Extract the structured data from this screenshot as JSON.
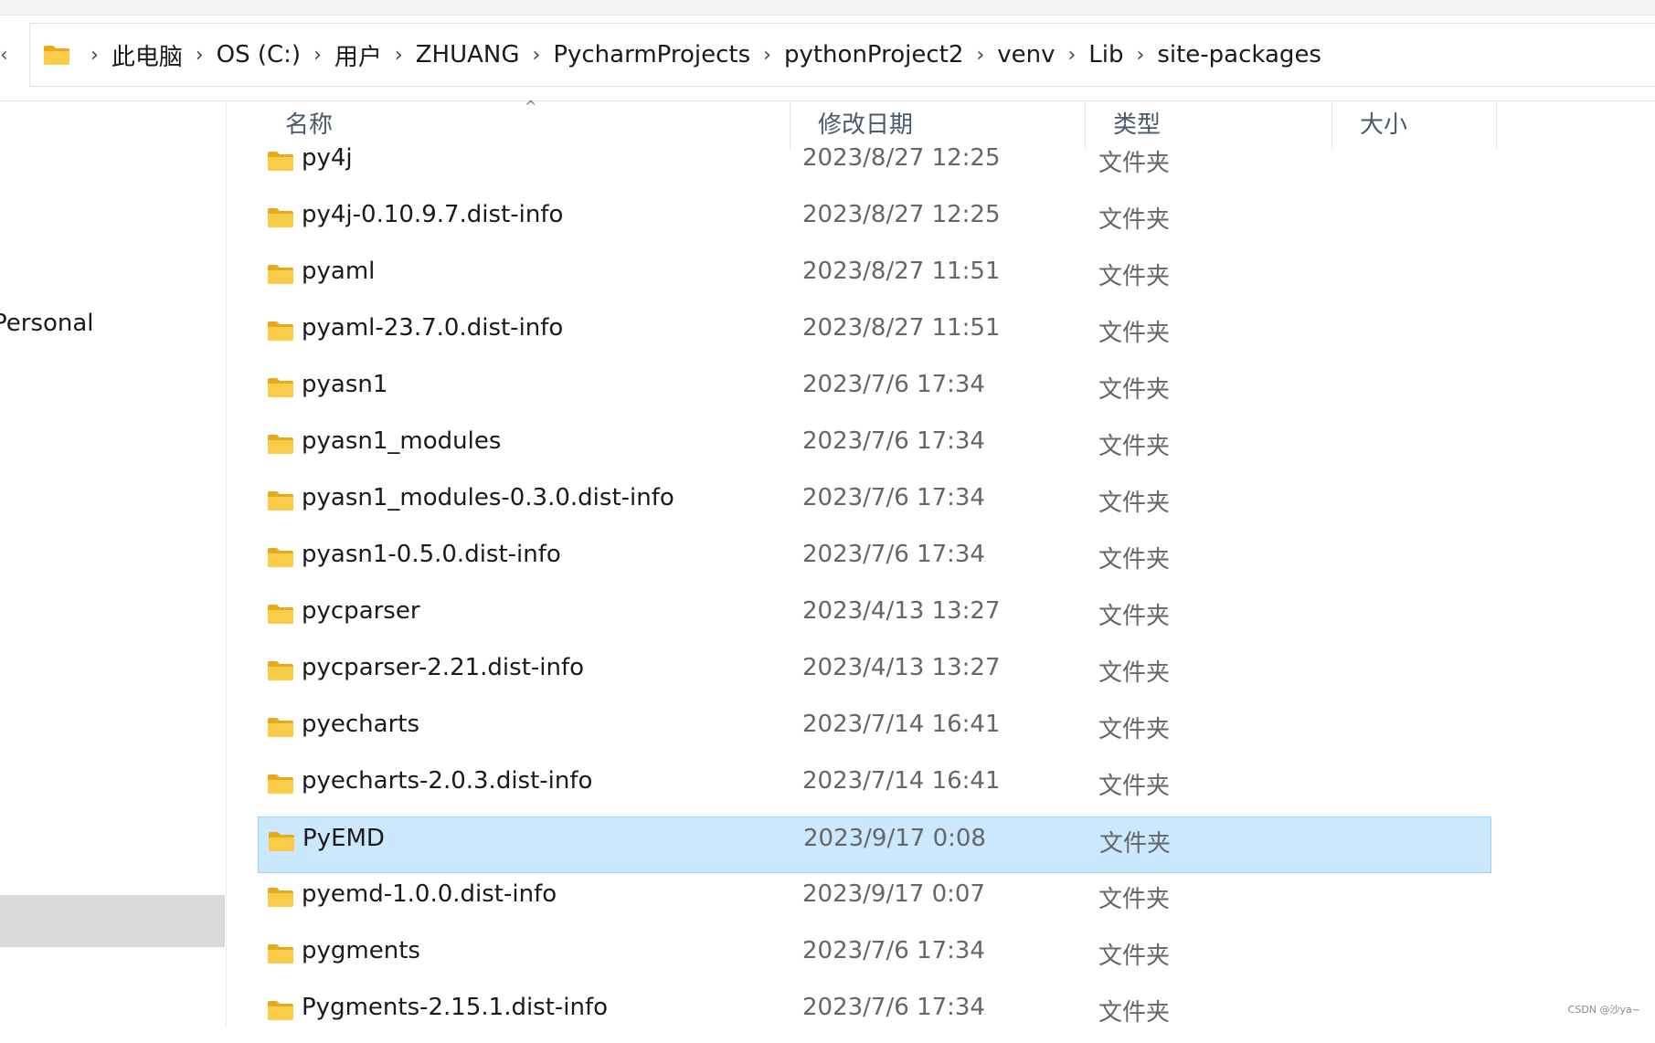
{
  "breadcrumb": {
    "items": [
      "此电脑",
      "OS (C:)",
      "用户",
      "ZHUANG",
      "PycharmProjects",
      "pythonProject2",
      "venv",
      "Lib",
      "site-packages"
    ],
    "separator": "›"
  },
  "nav_pane": {
    "visible_item": "Personal"
  },
  "columns": {
    "name": "名称",
    "date": "修改日期",
    "type": "类型",
    "size": "大小"
  },
  "files": [
    {
      "name": "py4j",
      "date": "2023/8/27 12:25",
      "type": "文件夹"
    },
    {
      "name": "py4j-0.10.9.7.dist-info",
      "date": "2023/8/27 12:25",
      "type": "文件夹"
    },
    {
      "name": "pyaml",
      "date": "2023/8/27 11:51",
      "type": "文件夹"
    },
    {
      "name": "pyaml-23.7.0.dist-info",
      "date": "2023/8/27 11:51",
      "type": "文件夹"
    },
    {
      "name": "pyasn1",
      "date": "2023/7/6 17:34",
      "type": "文件夹"
    },
    {
      "name": "pyasn1_modules",
      "date": "2023/7/6 17:34",
      "type": "文件夹"
    },
    {
      "name": "pyasn1_modules-0.3.0.dist-info",
      "date": "2023/7/6 17:34",
      "type": "文件夹"
    },
    {
      "name": "pyasn1-0.5.0.dist-info",
      "date": "2023/7/6 17:34",
      "type": "文件夹"
    },
    {
      "name": "pycparser",
      "date": "2023/4/13 13:27",
      "type": "文件夹"
    },
    {
      "name": "pycparser-2.21.dist-info",
      "date": "2023/4/13 13:27",
      "type": "文件夹"
    },
    {
      "name": "pyecharts",
      "date": "2023/7/14 16:41",
      "type": "文件夹"
    },
    {
      "name": "pyecharts-2.0.3.dist-info",
      "date": "2023/7/14 16:41",
      "type": "文件夹"
    },
    {
      "name": "PyEMD",
      "date": "2023/9/17 0:08",
      "type": "文件夹"
    },
    {
      "name": "pyemd-1.0.0.dist-info",
      "date": "2023/9/17 0:07",
      "type": "文件夹"
    },
    {
      "name": "pygments",
      "date": "2023/7/6 17:34",
      "type": "文件夹"
    },
    {
      "name": "Pygments-2.15.1.dist-info",
      "date": "2023/7/6 17:34",
      "type": "文件夹"
    }
  ],
  "selected_file": "PyEMD",
  "watermark": "CSDN @沙ya~",
  "colors": {
    "selection_bg": "#cce8ff",
    "selection_border": "#99d1ff",
    "folder_yellow": "#f8c73d"
  }
}
